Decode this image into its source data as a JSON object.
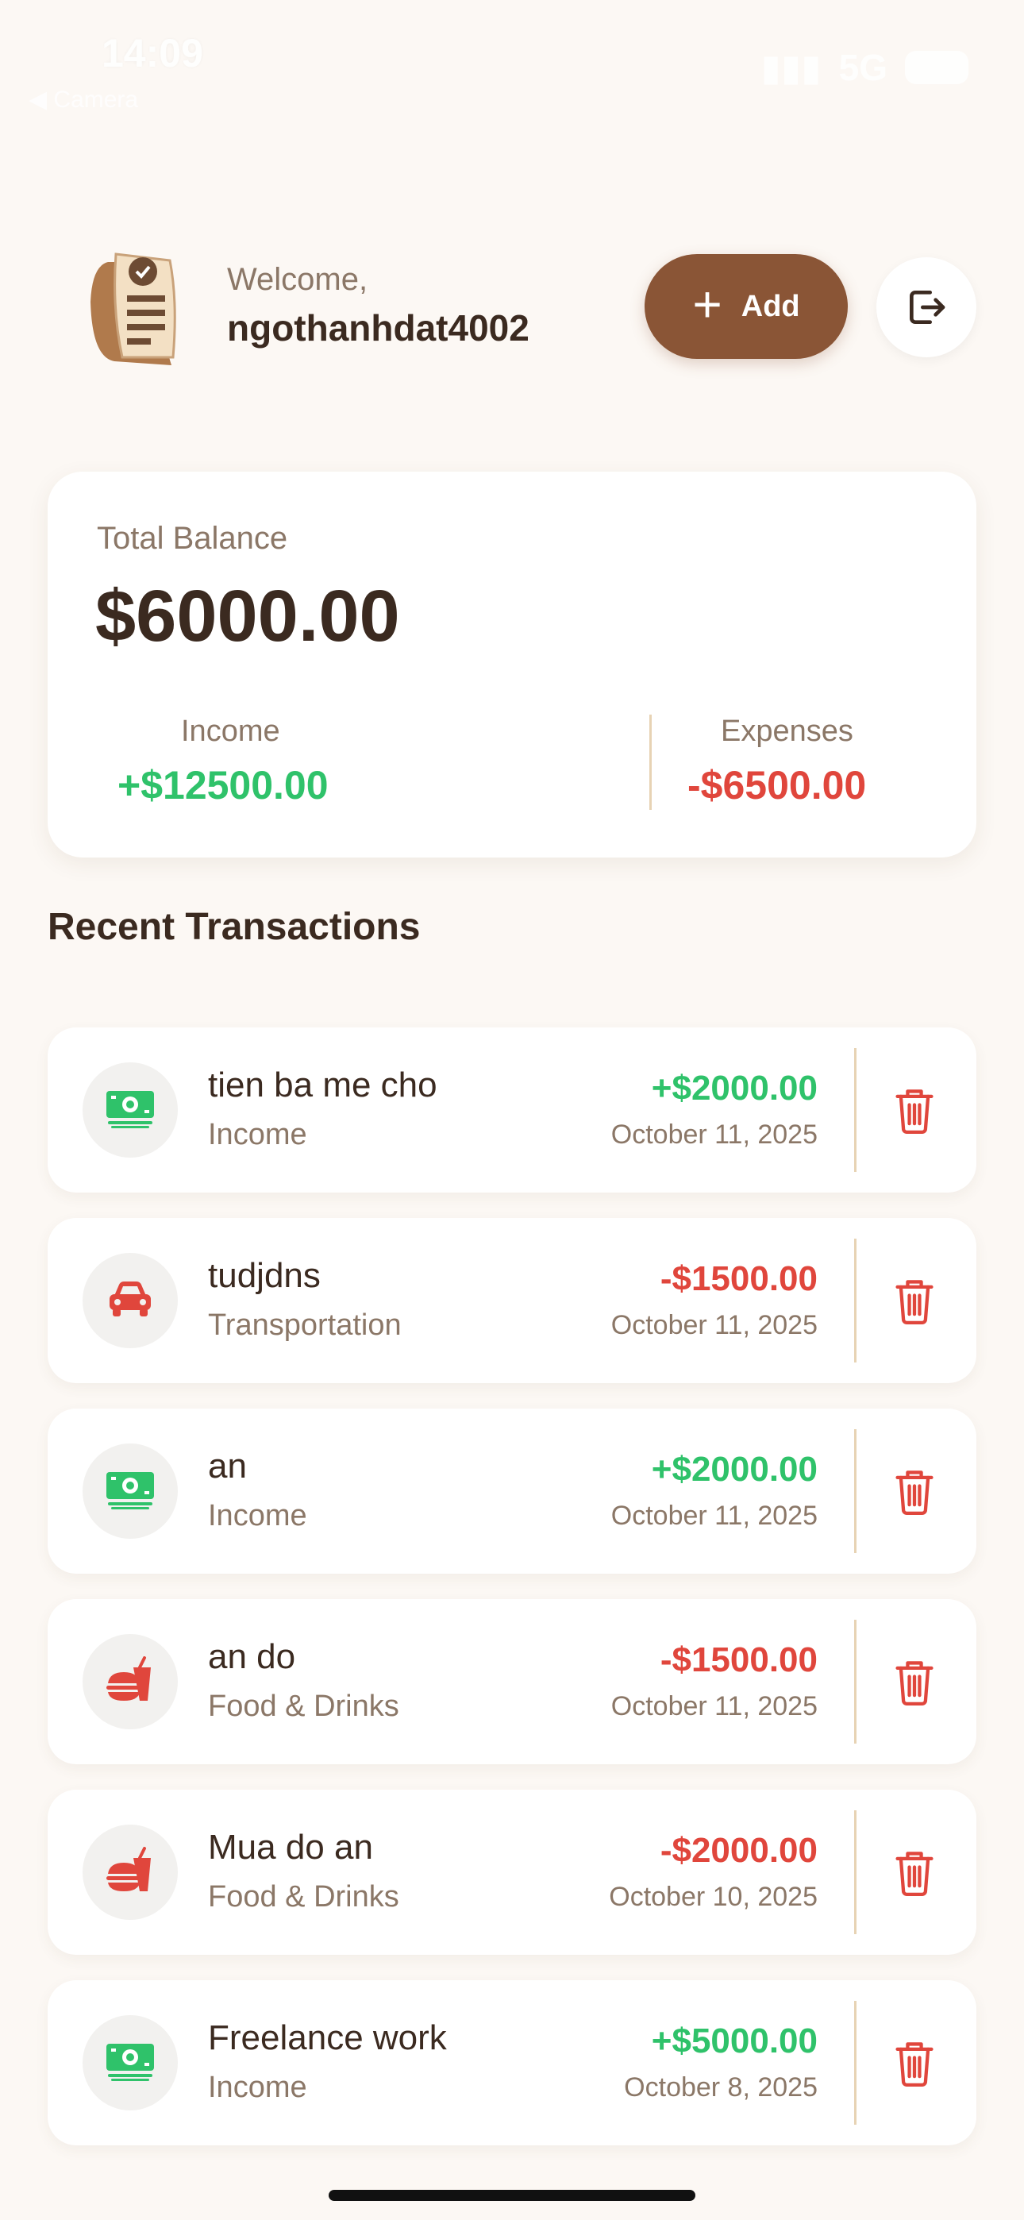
{
  "status": {
    "time": "14:09",
    "back_label": "◀ Camera",
    "network": "5G"
  },
  "header": {
    "welcome": "Welcome,",
    "username": "ngothanhdat4002",
    "add_label": "Add"
  },
  "balance": {
    "label": "Total Balance",
    "value": "$6000.00",
    "income_label": "Income",
    "income_value": "+$12500.00",
    "expenses_label": "Expenses",
    "expenses_value": "-$6500.00"
  },
  "section_title": "Recent Transactions",
  "transactions": [
    {
      "title": "tien ba me cho",
      "category": "Income",
      "amount": "+$2000.00",
      "date": "October 11, 2025",
      "type": "income",
      "icon": "money-icon"
    },
    {
      "title": "tudjdns",
      "category": "Transportation",
      "amount": "-$1500.00",
      "date": "October 11, 2025",
      "type": "expense",
      "icon": "car-icon"
    },
    {
      "title": "an",
      "category": "Income",
      "amount": "+$2000.00",
      "date": "October 11, 2025",
      "type": "income",
      "icon": "money-icon"
    },
    {
      "title": "an do",
      "category": "Food & Drinks",
      "amount": "-$1500.00",
      "date": "October 11, 2025",
      "type": "expense",
      "icon": "fastfood-icon"
    },
    {
      "title": "Mua do an",
      "category": "Food & Drinks",
      "amount": "-$2000.00",
      "date": "October 10, 2025",
      "type": "expense",
      "icon": "fastfood-icon"
    },
    {
      "title": "Freelance work",
      "category": "Income",
      "amount": "+$5000.00",
      "date": "October 8, 2025",
      "type": "income",
      "icon": "money-icon"
    }
  ],
  "colors": {
    "accent": "#8a5536",
    "income": "#2fc26a",
    "expense": "#e0463c",
    "background": "#fcf8f4"
  }
}
